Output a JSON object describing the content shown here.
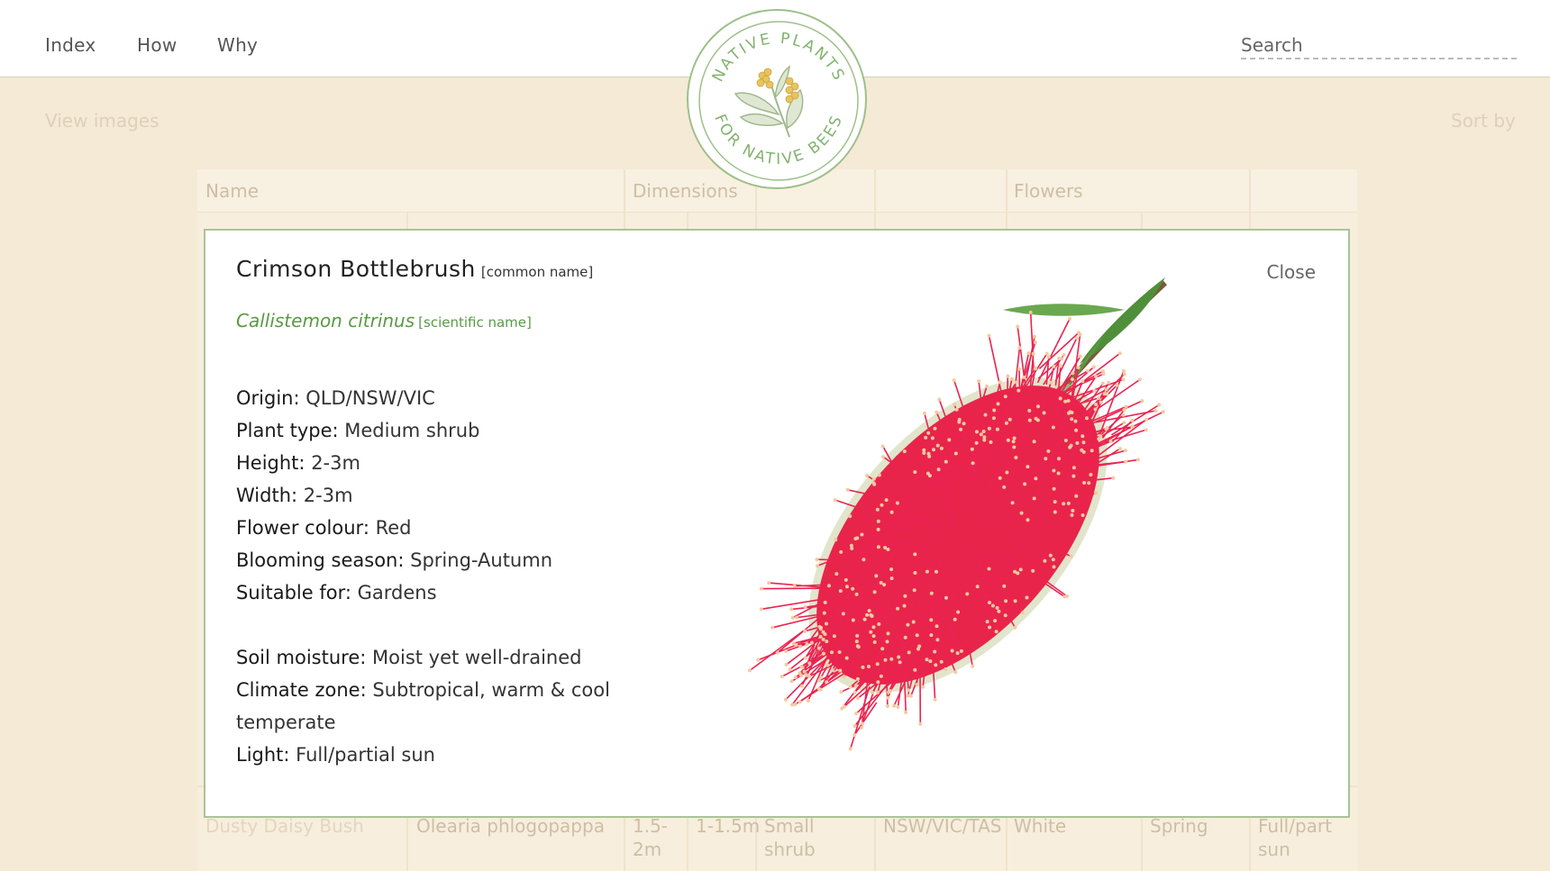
{
  "nav": {
    "index": "Index",
    "how": "How",
    "why": "Why",
    "search_placeholder": "Search"
  },
  "logo": {
    "top_text": "NATIVE PLANTS",
    "bottom_text": "FOR NATIVE BEES"
  },
  "toolbar": {
    "view_images": "View images",
    "sort_by": "Sort by"
  },
  "table": {
    "headers": [
      "Name",
      "Dimensions",
      "Flowers"
    ],
    "visible_row": {
      "name": "Dusty Daisy Bush",
      "scientific": "Olearia phlogopappa",
      "height": "1.5-2m",
      "width": "1-1.5m",
      "type": "Small shrub",
      "origin": "NSW/VIC/TAS",
      "colour": "White",
      "season": "Spring",
      "light": "Full/part sun"
    }
  },
  "modal": {
    "common_name": "Crimson Bottlebrush",
    "common_tag": "[common name]",
    "scientific_name": "Callistemon citrinus",
    "scientific_tag": "[scientific name]",
    "close_label": "Close",
    "attributes_1": [
      {
        "label": "Origin:",
        "value": "QLD/NSW/VIC"
      },
      {
        "label": "Plant type:",
        "value": "Medium shrub"
      },
      {
        "label": "Height:",
        "value": "2-3m"
      },
      {
        "label": "Width:",
        "value": "2-3m"
      },
      {
        "label": "Flower colour:",
        "value": "Red"
      },
      {
        "label": "Blooming season:",
        "value": "Spring-Autumn"
      },
      {
        "label": "Suitable for:",
        "value": "Gardens"
      }
    ],
    "attributes_2": [
      {
        "label": "Soil moisture:",
        "value": "Moist yet well-drained"
      },
      {
        "label": "Climate zone:",
        "value": "Subtropical, warm & cool temperate"
      },
      {
        "label": "Light:",
        "value": "Full/partial sun"
      }
    ]
  },
  "colors": {
    "page_bg": "#f5ead6",
    "accent_green": "#5a9a45",
    "flower_red": "#e8244a"
  }
}
